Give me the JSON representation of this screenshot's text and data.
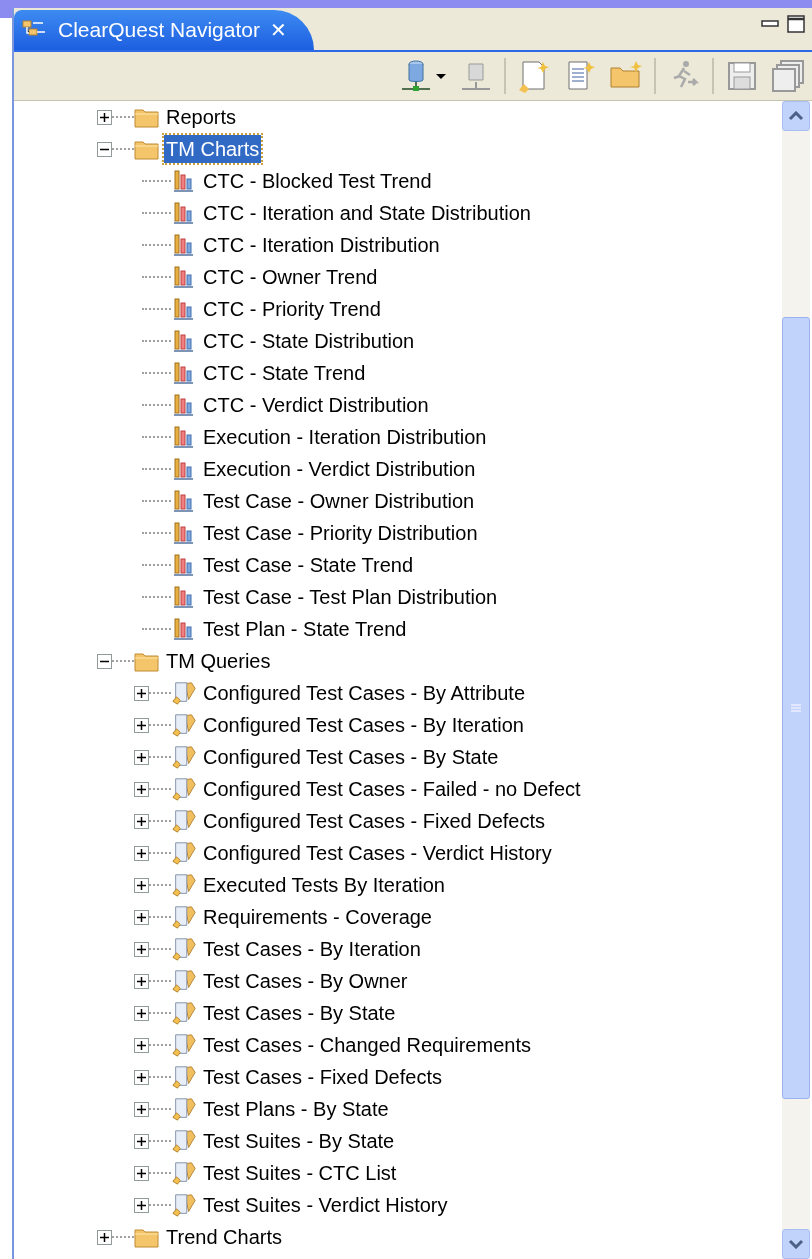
{
  "view": {
    "title": "ClearQuest Navigator",
    "close": "✕"
  },
  "tree": [
    {
      "label": "Reports",
      "kind": "folder",
      "expanded": false,
      "selected": false
    },
    {
      "label": "TM Charts",
      "kind": "folder",
      "expanded": true,
      "selected": true,
      "children": [
        {
          "label": "CTC - Blocked Test Trend",
          "kind": "chart",
          "selected": false
        },
        {
          "label": "CTC - Iteration and State Distribution",
          "kind": "chart",
          "selected": false
        },
        {
          "label": "CTC - Iteration Distribution",
          "kind": "chart",
          "selected": false
        },
        {
          "label": "CTC - Owner Trend",
          "kind": "chart",
          "selected": false
        },
        {
          "label": "CTC - Priority Trend",
          "kind": "chart",
          "selected": false
        },
        {
          "label": "CTC - State Distribution",
          "kind": "chart",
          "selected": false
        },
        {
          "label": "CTC - State Trend",
          "kind": "chart",
          "selected": false
        },
        {
          "label": "CTC - Verdict Distribution",
          "kind": "chart",
          "selected": false
        },
        {
          "label": "Execution - Iteration Distribution",
          "kind": "chart",
          "selected": false
        },
        {
          "label": "Execution - Verdict Distribution",
          "kind": "chart",
          "selected": false
        },
        {
          "label": "Test Case - Owner Distribution",
          "kind": "chart",
          "selected": false
        },
        {
          "label": "Test Case - Priority Distribution",
          "kind": "chart",
          "selected": false
        },
        {
          "label": "Test Case - State Trend",
          "kind": "chart",
          "selected": false
        },
        {
          "label": "Test Case - Test Plan Distribution",
          "kind": "chart",
          "selected": false
        },
        {
          "label": "Test Plan - State Trend",
          "kind": "chart",
          "selected": false
        }
      ]
    },
    {
      "label": "TM Queries",
      "kind": "folder",
      "expanded": true,
      "selected": false,
      "children": [
        {
          "label": "Configured Test Cases - By Attribute",
          "kind": "query",
          "expanded": false,
          "selected": false
        },
        {
          "label": "Configured Test Cases - By Iteration",
          "kind": "query",
          "expanded": false,
          "selected": false
        },
        {
          "label": "Configured Test Cases - By State",
          "kind": "query",
          "expanded": false,
          "selected": false
        },
        {
          "label": "Configured Test Cases - Failed - no Defect",
          "kind": "query",
          "expanded": false,
          "selected": false
        },
        {
          "label": "Configured Test Cases - Fixed Defects",
          "kind": "query",
          "expanded": false,
          "selected": false
        },
        {
          "label": "Configured Test Cases - Verdict History",
          "kind": "query",
          "expanded": false,
          "selected": false
        },
        {
          "label": "Executed Tests By Iteration",
          "kind": "query",
          "expanded": false,
          "selected": false
        },
        {
          "label": "Requirements - Coverage",
          "kind": "query",
          "expanded": false,
          "selected": false
        },
        {
          "label": "Test Cases - By Iteration",
          "kind": "query",
          "expanded": false,
          "selected": false
        },
        {
          "label": "Test Cases - By Owner",
          "kind": "query",
          "expanded": false,
          "selected": false
        },
        {
          "label": "Test Cases - By State",
          "kind": "query",
          "expanded": false,
          "selected": false
        },
        {
          "label": "Test Cases - Changed Requirements",
          "kind": "query",
          "expanded": false,
          "selected": false
        },
        {
          "label": "Test Cases - Fixed Defects",
          "kind": "query",
          "expanded": false,
          "selected": false
        },
        {
          "label": "Test Plans - By State",
          "kind": "query",
          "expanded": false,
          "selected": false
        },
        {
          "label": "Test Suites - By State",
          "kind": "query",
          "expanded": false,
          "selected": false
        },
        {
          "label": "Test Suites - CTC List",
          "kind": "query",
          "expanded": false,
          "selected": false
        },
        {
          "label": "Test Suites - Verdict History",
          "kind": "query",
          "expanded": false,
          "selected": false
        }
      ]
    },
    {
      "label": "Trend Charts",
      "kind": "folder",
      "expanded": false,
      "selected": false
    }
  ]
}
